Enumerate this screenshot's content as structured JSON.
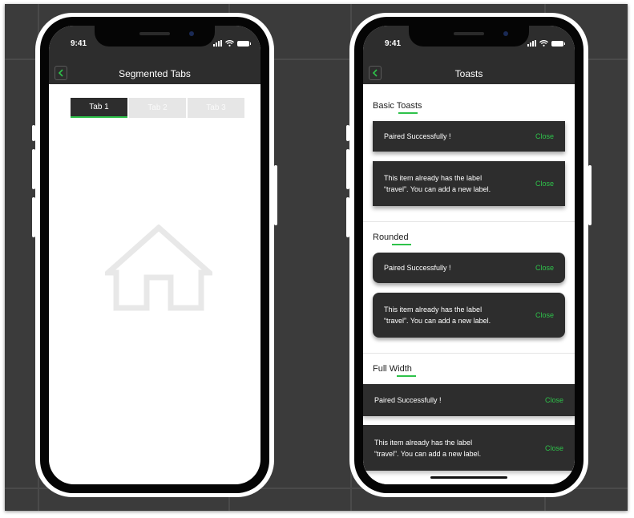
{
  "status_bar": {
    "time": "9:41"
  },
  "left_screen": {
    "title": "Segmented Tabs",
    "tabs": [
      {
        "label": "Tab 1",
        "active": true
      },
      {
        "label": "Tab 2",
        "active": false
      },
      {
        "label": "Tab 3",
        "active": false
      }
    ],
    "content_icon": "home-icon"
  },
  "right_screen": {
    "title": "Toasts",
    "sections": [
      {
        "title": "Basic Toasts",
        "toasts": [
          {
            "message": "Paired Successfully !",
            "action": "Close"
          },
          {
            "message_line1": "This item already has the label",
            "message_line2": "“travel”. You can add a new label.",
            "action": "Close"
          }
        ]
      },
      {
        "title": "Rounded",
        "toasts": [
          {
            "message": "Paired Successfully !",
            "action": "Close"
          },
          {
            "message_line1": "This item already has the label",
            "message_line2": "“travel”. You can add a new label.",
            "action": "Close"
          }
        ]
      },
      {
        "title": "Full Width",
        "toasts": [
          {
            "message": "Paired Successfully !",
            "action": "Close"
          },
          {
            "message_line1": "This item already has the label",
            "message_line2": "“travel”. You can add a new label.",
            "action": "Close"
          }
        ]
      }
    ]
  },
  "colors": {
    "accent": "#2ec24a",
    "bar": "#2d2d2d",
    "background": "#3b3b3b"
  }
}
